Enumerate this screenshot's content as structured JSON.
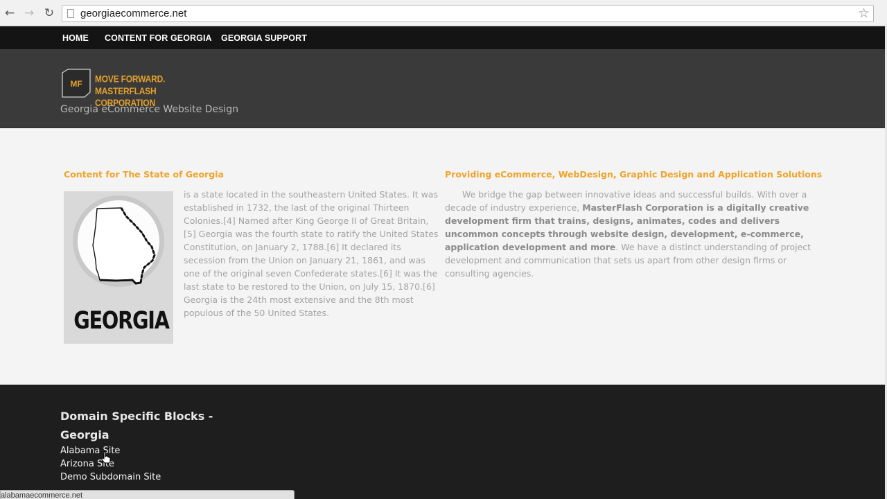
{
  "browser": {
    "url": "georgiaecommerce.net",
    "back_icon": "arrow-left-icon",
    "forward_icon": "arrow-right-icon",
    "reload_icon": "reload-icon",
    "star_icon": "star-icon",
    "status_url": "alabamaecommerce.net"
  },
  "nav": {
    "items": [
      "HOME",
      "CONTENT FOR GEORGIA",
      "GEORGIA SUPPORT"
    ]
  },
  "header": {
    "logo_mark": "MF",
    "logo_line1": "MOVE FORWARD.",
    "logo_line2": "MASTERFLASH CORPORATION",
    "tagline": "Georgia eCommerce Website Design"
  },
  "main": {
    "left_heading": "Content for The State of Georgia",
    "georgia_label": "GEORGIA",
    "left_text": "is a state located in the southeastern United States. It was established in 1732, the last of the original Thirteen Colonies.[4] Named after King George II of Great Britain,[5] Georgia was the fourth state to ratify the United States Constitution, on January 2, 1788.[6] It declared its secession from the Union on January 21, 1861, and was one of the original seven Confederate states.[6] It was the last state to be restored to the Union, on July 15, 1870.[6] Georgia is the 24th most extensive and the 8th most populous of the 50 United States.",
    "right_heading": "Providing eCommerce, WebDesign, Graphic Design and Application Solutions",
    "right_text_1": "We bridge the gap between innovative ideas and successful builds. With over a decade of industry experience, ",
    "right_text_bold": "MasterFlash Corporation is a digitally creative development firm that trains, designs, animates, codes and delivers uncommon concepts through website design, development, e-commerce, application development and more",
    "right_text_2": ". We have a distinct understanding of project development and communication that sets us apart from other design firms or consulting agencies."
  },
  "footer": {
    "title": "Domain Specific Blocks - Georgia",
    "links": [
      "Alabama Site",
      "Arizona Site",
      "Demo Subdomain Site"
    ]
  },
  "colors": {
    "accent": "#f0a42a",
    "nav_bg": "#141414",
    "header_bg": "#3a3a3a",
    "footer_bg": "#1e1e1e"
  }
}
